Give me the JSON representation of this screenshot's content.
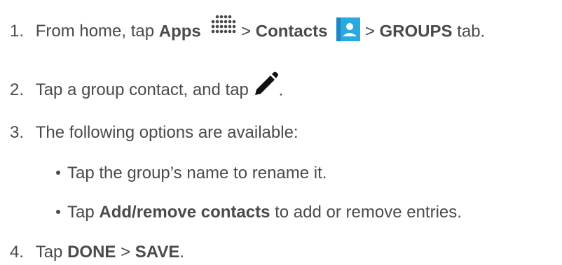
{
  "steps": [
    {
      "number": "1.",
      "text_1": "From home, tap ",
      "bold_1": "Apps",
      "text_2": " > ",
      "bold_2": "Contacts",
      "text_3": " > ",
      "bold_3": "GROUPS",
      "text_4": " tab.",
      "icons": [
        "apps-grid-icon",
        "contacts-icon"
      ]
    },
    {
      "number": "2.",
      "text_1": "Tap a group contact, and tap ",
      "text_2": ".",
      "icons": [
        "pencil-edit-icon"
      ]
    },
    {
      "number": "3.",
      "text_1": "The following options are available:"
    },
    {
      "number": "4.",
      "text_1": "Tap ",
      "bold_1": "DONE",
      "text_2": " > ",
      "bold_2": "SAVE",
      "text_3": "."
    }
  ],
  "bullets": [
    {
      "text_1": "Tap the group’s name to rename it."
    },
    {
      "text_1": "Tap ",
      "bold_1": "Add/remove contacts",
      "text_2": " to add or remove entries."
    }
  ],
  "colors": {
    "text": "#4a4a4a",
    "contacts_icon_bg": "#2aa8e0",
    "contacts_icon_fg": "#ffffff"
  }
}
